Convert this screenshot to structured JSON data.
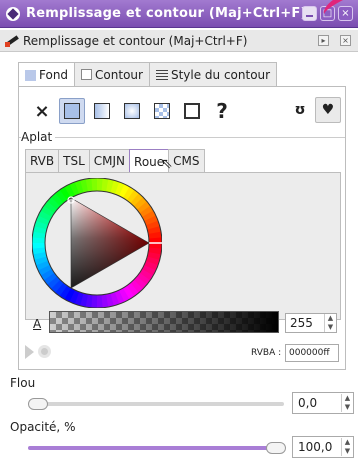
{
  "window": {
    "title": "Remplissage et contour (Maj+Ctrl+F)",
    "colors": {
      "titlebar": "#7a4db0",
      "accent": "#a97ed6"
    }
  },
  "dock": {
    "title": "Remplissage et contour (Maj+Ctrl+F)"
  },
  "tabs": [
    {
      "label": "Fond",
      "active": true
    },
    {
      "label": "Contour",
      "active": false
    },
    {
      "label": "Style du contour",
      "active": false
    }
  ],
  "fill_modes": [
    {
      "icon": "no-paint-icon",
      "label": "×"
    },
    {
      "icon": "flat-color-icon",
      "active": true
    },
    {
      "icon": "linear-gradient-icon"
    },
    {
      "icon": "radial-gradient-icon"
    },
    {
      "icon": "pattern-icon"
    },
    {
      "icon": "swatch-icon"
    },
    {
      "icon": "unset-paint-icon",
      "label": "?"
    }
  ],
  "fill_rules": [
    "evenodd-icon",
    "nonzero-icon"
  ],
  "section": {
    "label": "Aplat"
  },
  "color_tabs": [
    {
      "label": "RVB"
    },
    {
      "label": "TSL"
    },
    {
      "label": "CMJN"
    },
    {
      "label": "Roue",
      "active": true
    },
    {
      "label": "CMS"
    }
  ],
  "color": {
    "current": "#000000",
    "hue_color": "#ff0000"
  },
  "alpha": {
    "label": "A",
    "value": "255"
  },
  "rgba": {
    "label": "RVBA :",
    "value": "000000ff"
  },
  "blur": {
    "label": "Flou",
    "value": "0,0",
    "level": 0
  },
  "opacity": {
    "label": "Opacité, %",
    "value": "100,0",
    "level": 100
  }
}
